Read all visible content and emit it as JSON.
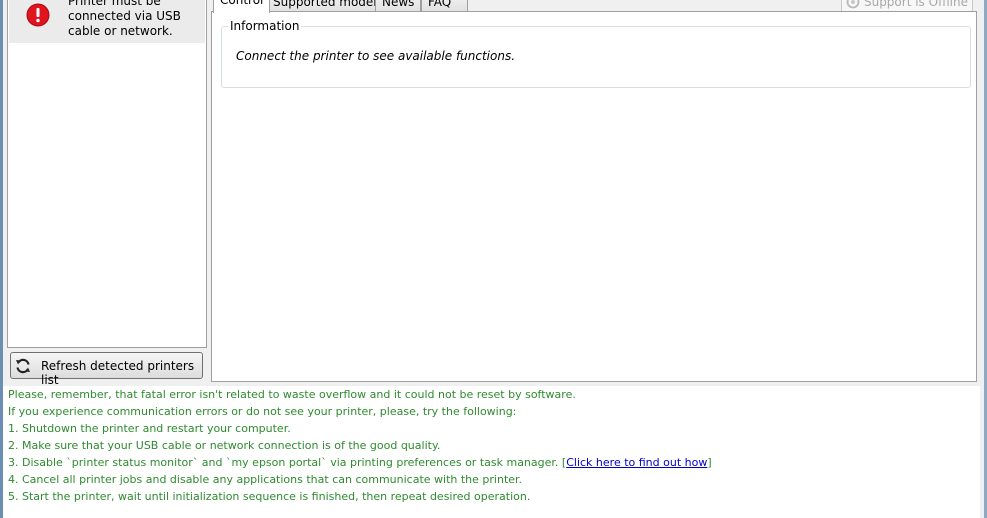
{
  "printer_list": {
    "items": [
      {
        "status_icon": "error-icon",
        "text": "Printer must be connected via USB cable or network."
      }
    ]
  },
  "refresh_button": {
    "label": "Refresh detected printers list",
    "icon": "refresh-icon"
  },
  "tabs": [
    {
      "label": "Control",
      "active": true
    },
    {
      "label": "Supported models",
      "active": false
    },
    {
      "label": "News",
      "active": false
    },
    {
      "label": "FAQ",
      "active": false
    }
  ],
  "support_status": {
    "label": "Support is Offline",
    "icon": "support-icon"
  },
  "info_group": {
    "legend": "Information",
    "message": "Connect the printer to see available functions."
  },
  "help": {
    "lines": [
      "Please, remember, that fatal error isn't related to waste overflow and it could not be reset by software.",
      "If you experience communication errors or do not see your printer, please, try the following:",
      "1. Shutdown the printer and restart your computer.",
      "2. Make sure that your USB cable or network connection is of the good quality.",
      "3. Disable `printer status monitor` and `my epson portal` via printing preferences or task manager.",
      "4. Cancel all printer jobs and disable any applications that can communicate with the printer.",
      "5. Start the printer, wait until initialization sequence is finished, then repeat desired operation."
    ],
    "link_text": "Click here to find out how"
  },
  "colors": {
    "help_text": "#2e8b2e",
    "link": "#0000cc",
    "error_red": "#e0141e"
  }
}
